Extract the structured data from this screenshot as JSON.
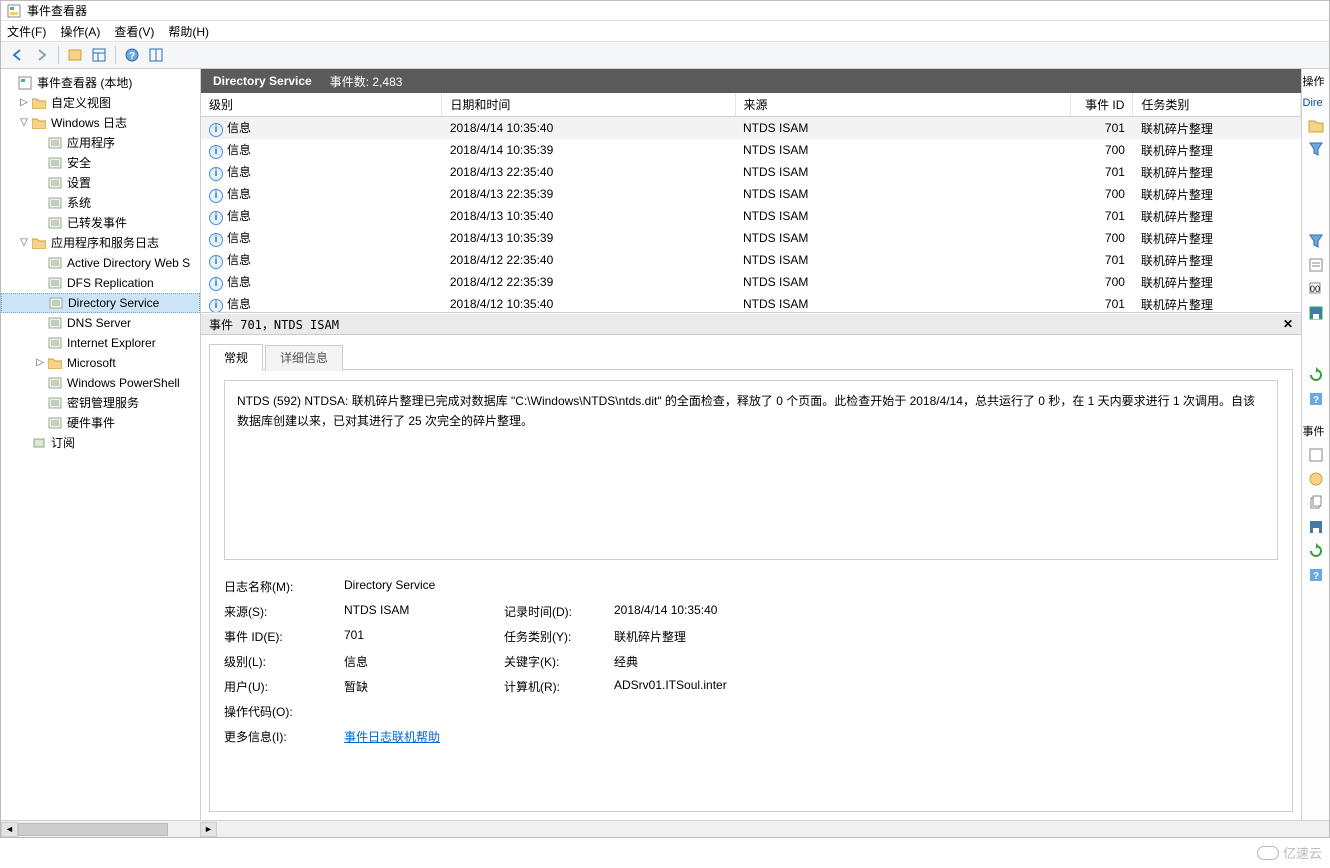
{
  "window": {
    "title": "事件查看器"
  },
  "menu": {
    "file": "文件(F)",
    "action": "操作(A)",
    "view": "查看(V)",
    "help": "帮助(H)"
  },
  "tree": {
    "root": "事件查看器 (本地)",
    "custom": "自定义视图",
    "winlogs": "Windows 日志",
    "winlogs_items": [
      "应用程序",
      "安全",
      "设置",
      "系统",
      "已转发事件"
    ],
    "appsrv": "应用程序和服务日志",
    "appsrv_items": [
      "Active Directory Web S",
      "DFS Replication",
      "Directory Service",
      "DNS Server",
      "Internet Explorer",
      "Microsoft",
      "Windows PowerShell",
      "密钥管理服务",
      "硬件事件"
    ],
    "subs": "订阅"
  },
  "center": {
    "title": "Directory Service",
    "count_label": "事件数:",
    "count": "2,483",
    "cols": {
      "level": "级别",
      "date": "日期和时间",
      "source": "来源",
      "id": "事件 ID",
      "task": "任务类别"
    },
    "rows": [
      {
        "level": "信息",
        "date": "2018/4/14 10:35:40",
        "src": "NTDS ISAM",
        "id": "701",
        "task": "联机碎片整理"
      },
      {
        "level": "信息",
        "date": "2018/4/14 10:35:39",
        "src": "NTDS ISAM",
        "id": "700",
        "task": "联机碎片整理"
      },
      {
        "level": "信息",
        "date": "2018/4/13 22:35:40",
        "src": "NTDS ISAM",
        "id": "701",
        "task": "联机碎片整理"
      },
      {
        "level": "信息",
        "date": "2018/4/13 22:35:39",
        "src": "NTDS ISAM",
        "id": "700",
        "task": "联机碎片整理"
      },
      {
        "level": "信息",
        "date": "2018/4/13 10:35:40",
        "src": "NTDS ISAM",
        "id": "701",
        "task": "联机碎片整理"
      },
      {
        "level": "信息",
        "date": "2018/4/13 10:35:39",
        "src": "NTDS ISAM",
        "id": "700",
        "task": "联机碎片整理"
      },
      {
        "level": "信息",
        "date": "2018/4/12 22:35:40",
        "src": "NTDS ISAM",
        "id": "701",
        "task": "联机碎片整理"
      },
      {
        "level": "信息",
        "date": "2018/4/12 22:35:39",
        "src": "NTDS ISAM",
        "id": "700",
        "task": "联机碎片整理"
      },
      {
        "level": "信息",
        "date": "2018/4/12 10:35:40",
        "src": "NTDS ISAM",
        "id": "701",
        "task": "联机碎片整理"
      }
    ]
  },
  "detail": {
    "header": "事件 701，NTDS ISAM",
    "tab_general": "常规",
    "tab_details": "详细信息",
    "description": "NTDS (592) NTDSA: 联机碎片整理已完成对数据库 \"C:\\Windows\\NTDS\\ntds.dit\" 的全面检查，释放了 0 个页面。此检查开始于 2018/4/14，总共运行了 0 秒，在 1 天内要求进行 1 次调用。自该数据库创建以来，已对其进行了 25 次完全的碎片整理。",
    "labels": {
      "logname": "日志名称(M):",
      "source": "来源(S):",
      "eventid": "事件 ID(E):",
      "level": "级别(L):",
      "user": "用户(U):",
      "opcode": "操作代码(O):",
      "moreinfo": "更多信息(I):",
      "logged": "记录时间(D):",
      "task": "任务类别(Y):",
      "keywords": "关键字(K):",
      "computer": "计算机(R):"
    },
    "values": {
      "logname": "Directory Service",
      "source": "NTDS ISAM",
      "eventid": "701",
      "level": "信息",
      "user": "暂缺",
      "opcode": "",
      "moreinfo": "事件日志联机帮助",
      "logged": "2018/4/14 10:35:40",
      "task": "联机碎片整理",
      "keywords": "经典",
      "computer": "ADSrv01.ITSoul.inter"
    }
  },
  "rightpane": {
    "header": "操作",
    "subheader": "Dire",
    "subheader2": "事件"
  },
  "watermark": "亿速云"
}
